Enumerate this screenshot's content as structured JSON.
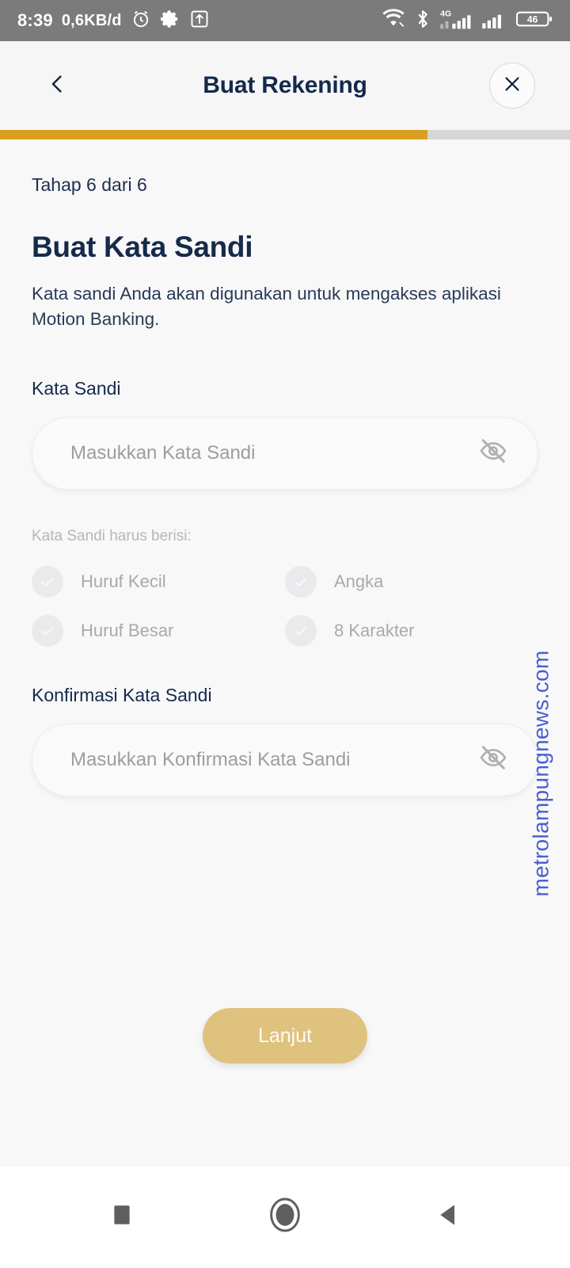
{
  "status_bar": {
    "time": "8:39",
    "data_rate": "0,6KB/d",
    "battery_level": "46",
    "network_type": "4G",
    "icons": [
      "alarm-clock-icon",
      "gear-icon",
      "upload-box-icon",
      "wifi-icon",
      "bluetooth-icon",
      "signal-4g-icon",
      "signal-icon",
      "battery-icon"
    ],
    "background_color": "#7b7b7b"
  },
  "header": {
    "title": "Buat Rekening",
    "back_icon": "chevron-left-icon",
    "close_icon": "close-icon",
    "title_color": "#14294b"
  },
  "progress": {
    "percent": 75,
    "fill_color": "#d8a01f",
    "track_color": "#d6d6d6"
  },
  "main": {
    "step_label": "Tahap 6 dari 6",
    "title": "Buat Kata Sandi",
    "description": "Kata sandi Anda akan digunakan untuk mengakses aplikasi Motion Banking.",
    "password": {
      "label": "Kata Sandi",
      "placeholder": "Masukkan Kata Sandi",
      "value": "",
      "toggle_icon": "eye-off-icon"
    },
    "requirements": {
      "caption": "Kata Sandi harus berisi:",
      "items": [
        {
          "label": "Huruf Kecil",
          "met": false
        },
        {
          "label": "Angka",
          "met": false
        },
        {
          "label": "Huruf Besar",
          "met": false
        },
        {
          "label": "8 Karakter",
          "met": false
        }
      ]
    },
    "confirm_password": {
      "label": "Konfirmasi Kata Sandi",
      "placeholder": "Masukkan Konfirmasi Kata Sandi",
      "value": "",
      "toggle_icon": "eye-off-icon"
    },
    "submit_label": "Lanjut",
    "submit_color": "#dfc27d"
  },
  "watermark": {
    "text": "metrolampungnews.com",
    "color": "#4a5fd0"
  },
  "navbar": {
    "recents_icon": "square-icon",
    "home_icon": "circle-icon",
    "back_icon": "triangle-back-icon"
  }
}
